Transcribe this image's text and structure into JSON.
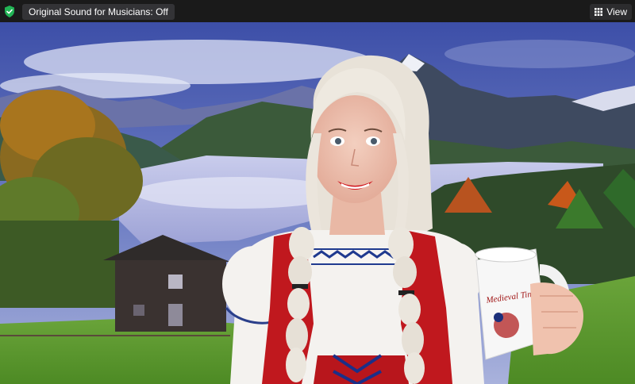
{
  "toolbar": {
    "audio_status": "Original Sound for Musicians: Off",
    "view_label": "View",
    "security_icon": "shield-check-icon",
    "view_icon": "grid-icon"
  },
  "video": {
    "mug_text": "Medieval Times"
  },
  "colors": {
    "topbar_bg": "#1a1a1a",
    "shield_green": "#22b455",
    "pill_bg": "#333336"
  }
}
